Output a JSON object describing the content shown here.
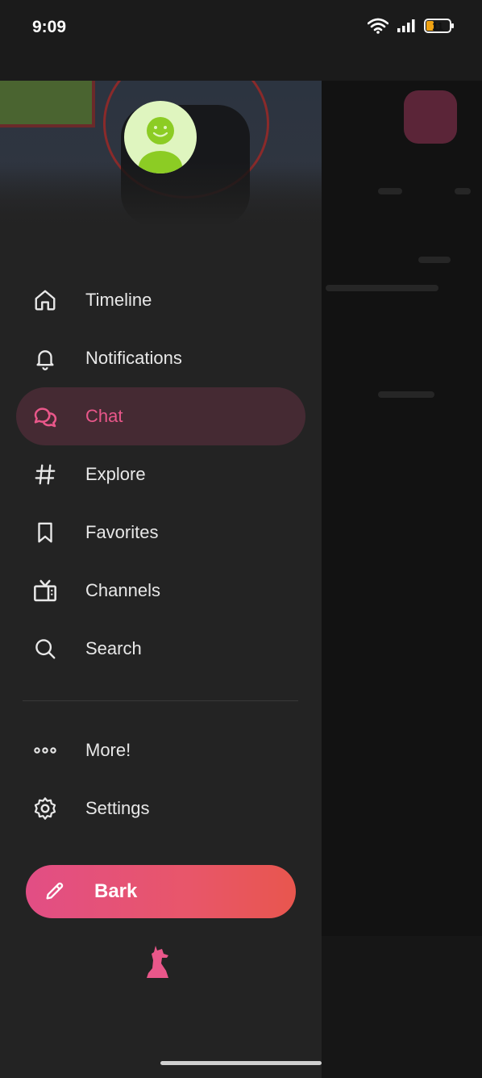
{
  "status_bar": {
    "time": "9:09",
    "battery": "11",
    "battery_color": "#f0a313"
  },
  "drawer": {
    "menu": [
      {
        "label": "Timeline",
        "icon": "home-icon"
      },
      {
        "label": "Notifications",
        "icon": "bell-icon"
      },
      {
        "label": "Chat",
        "icon": "chat-bubbles-icon",
        "active": true
      },
      {
        "label": "Explore",
        "icon": "hashtag-icon"
      },
      {
        "label": "Favorites",
        "icon": "bookmark-icon"
      },
      {
        "label": "Channels",
        "icon": "tv-icon"
      },
      {
        "label": "Search",
        "icon": "search-icon"
      }
    ],
    "secondary_menu": [
      {
        "label": "More!",
        "icon": "more-dots-icon"
      },
      {
        "label": "Settings",
        "icon": "gear-icon"
      }
    ],
    "bark_button": {
      "label": "Bark",
      "icon": "pencil-icon"
    },
    "logo_icon": "dog-logo-icon"
  },
  "colors": {
    "accent": "#e9578a",
    "drawer_bg": "#232323",
    "active_bg": "#452a33",
    "avatar_bg": "#dff5bf",
    "avatar_fg": "#8ccc24"
  }
}
